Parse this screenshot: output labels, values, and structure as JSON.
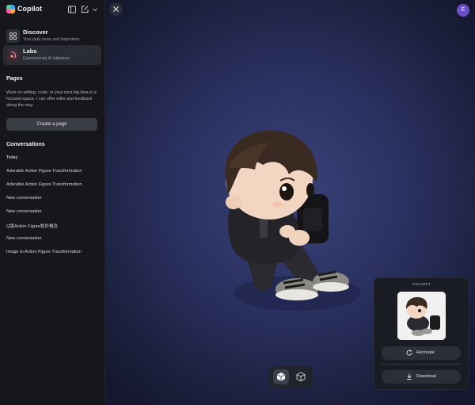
{
  "app": {
    "name": "Copilot"
  },
  "sidebar": {
    "nav": [
      {
        "title": "Discover",
        "subtitle": "Your daily news and inspiration",
        "icon": "grid-icon"
      },
      {
        "title": "Labs",
        "subtitle": "Experimental AI initiatives",
        "icon": "labs-icon"
      }
    ],
    "pages": {
      "heading": "Pages",
      "description": "Work on writing, code, or your next big idea in a focused space. I can offer edits and feedback along the way.",
      "create_label": "Create a page"
    },
    "conversations": {
      "heading": "Conversations",
      "group": "Today",
      "items": [
        "Adorable Action Figure Transformation",
        "Adorable Action Figure Transformation",
        "New conversation",
        "New conversation",
        "Q版Action Figure設計概念",
        "New conversation",
        "Image to Action Figure Transformation"
      ]
    }
  },
  "header": {
    "avatar_initial": "E"
  },
  "viewer": {
    "prompt_label": "PROMPT",
    "recreate_label": "Recreate",
    "download_label": "Download"
  },
  "colors": {
    "accent": "#6b4fc9",
    "background": "#2a3160"
  }
}
